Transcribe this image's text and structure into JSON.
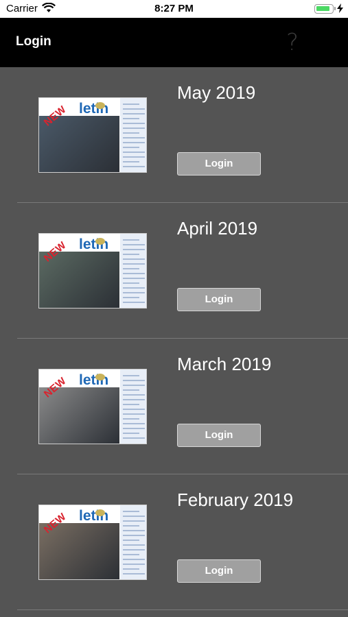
{
  "status_bar": {
    "carrier": "Carrier",
    "time": "8:27 PM",
    "battery_level": 0.85,
    "battery_color": "#4cd964"
  },
  "nav": {
    "title": "Login",
    "help_glyph": "?"
  },
  "issues": [
    {
      "title": "May 2019",
      "button_label": "Login",
      "cover_masthead": "letin",
      "cover_badge": "NEW",
      "photo_tint": "#4a5968"
    },
    {
      "title": "April 2019",
      "button_label": "Login",
      "cover_masthead": "letin",
      "cover_badge": "NEW",
      "photo_tint": "#5b6a62"
    },
    {
      "title": "March 2019",
      "button_label": "Login",
      "cover_masthead": "letin",
      "cover_badge": "NEW",
      "photo_tint": "#8a8a8a"
    },
    {
      "title": "February 2019",
      "button_label": "Login",
      "cover_masthead": "letin",
      "cover_badge": "NEW",
      "photo_tint": "#7a6e62"
    }
  ],
  "colors": {
    "background": "#545454",
    "nav_background": "#000000",
    "button_background": "#a0a0a0",
    "masthead": "#1f68b5",
    "badge": "#d9232e"
  }
}
